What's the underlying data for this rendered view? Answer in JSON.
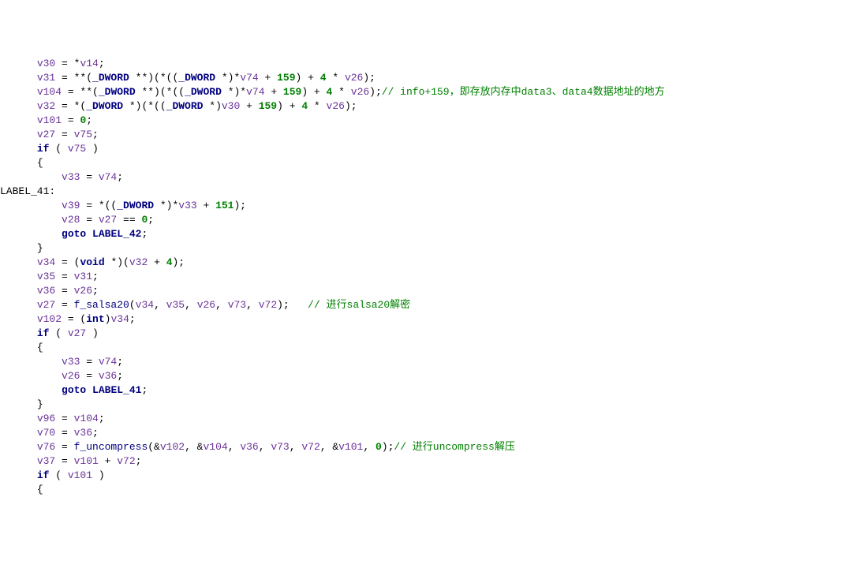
{
  "lines": [
    {
      "indent": 3,
      "tokens": [
        {
          "c": "var",
          "t": "v30"
        },
        {
          "c": "plain",
          "t": " = *"
        },
        {
          "c": "var",
          "t": "v14"
        },
        {
          "c": "plain",
          "t": ";"
        }
      ]
    },
    {
      "indent": 3,
      "tokens": [
        {
          "c": "var",
          "t": "v31"
        },
        {
          "c": "plain",
          "t": " = **("
        },
        {
          "c": "navy",
          "t": "_DWORD"
        },
        {
          "c": "plain",
          "t": " **)(*(("
        },
        {
          "c": "navy",
          "t": "_DWORD"
        },
        {
          "c": "plain",
          "t": " *)*"
        },
        {
          "c": "var",
          "t": "v74"
        },
        {
          "c": "plain",
          "t": " + "
        },
        {
          "c": "num",
          "t": "159"
        },
        {
          "c": "plain",
          "t": ") + "
        },
        {
          "c": "num",
          "t": "4"
        },
        {
          "c": "plain",
          "t": " * "
        },
        {
          "c": "var",
          "t": "v26"
        },
        {
          "c": "plain",
          "t": ");"
        }
      ]
    },
    {
      "indent": 3,
      "tokens": [
        {
          "c": "var",
          "t": "v104"
        },
        {
          "c": "plain",
          "t": " = **("
        },
        {
          "c": "navy",
          "t": "_DWORD"
        },
        {
          "c": "plain",
          "t": " **)(*(("
        },
        {
          "c": "navy",
          "t": "_DWORD"
        },
        {
          "c": "plain",
          "t": " *)*"
        },
        {
          "c": "var",
          "t": "v74"
        },
        {
          "c": "plain",
          "t": " + "
        },
        {
          "c": "num",
          "t": "159"
        },
        {
          "c": "plain",
          "t": ") + "
        },
        {
          "c": "num",
          "t": "4"
        },
        {
          "c": "plain",
          "t": " * "
        },
        {
          "c": "var",
          "t": "v26"
        },
        {
          "c": "plain",
          "t": ");"
        },
        {
          "c": "cmt",
          "t": "// info+159，即存放内存中data3、data4数据地址的地方"
        }
      ]
    },
    {
      "indent": 3,
      "tokens": [
        {
          "c": "var",
          "t": "v32"
        },
        {
          "c": "plain",
          "t": " = *("
        },
        {
          "c": "navy",
          "t": "_DWORD"
        },
        {
          "c": "plain",
          "t": " *)(*(("
        },
        {
          "c": "navy",
          "t": "_DWORD"
        },
        {
          "c": "plain",
          "t": " *)"
        },
        {
          "c": "var",
          "t": "v30"
        },
        {
          "c": "plain",
          "t": " + "
        },
        {
          "c": "num",
          "t": "159"
        },
        {
          "c": "plain",
          "t": ") + "
        },
        {
          "c": "num",
          "t": "4"
        },
        {
          "c": "plain",
          "t": " * "
        },
        {
          "c": "var",
          "t": "v26"
        },
        {
          "c": "plain",
          "t": ");"
        }
      ]
    },
    {
      "indent": 3,
      "tokens": [
        {
          "c": "var",
          "t": "v101"
        },
        {
          "c": "plain",
          "t": " = "
        },
        {
          "c": "num",
          "t": "0"
        },
        {
          "c": "plain",
          "t": ";"
        }
      ]
    },
    {
      "indent": 3,
      "tokens": [
        {
          "c": "var",
          "t": "v27"
        },
        {
          "c": "plain",
          "t": " = "
        },
        {
          "c": "var",
          "t": "v75"
        },
        {
          "c": "plain",
          "t": ";"
        }
      ]
    },
    {
      "indent": 3,
      "tokens": [
        {
          "c": "navy",
          "t": "if"
        },
        {
          "c": "plain",
          "t": " ( "
        },
        {
          "c": "var",
          "t": "v75"
        },
        {
          "c": "plain",
          "t": " )"
        }
      ]
    },
    {
      "indent": 3,
      "tokens": [
        {
          "c": "plain",
          "t": "{"
        }
      ]
    },
    {
      "indent": 5,
      "tokens": [
        {
          "c": "var",
          "t": "v33"
        },
        {
          "c": "plain",
          "t": " = "
        },
        {
          "c": "var",
          "t": "v74"
        },
        {
          "c": "plain",
          "t": ";"
        }
      ]
    },
    {
      "indent": 0,
      "tokens": [
        {
          "c": "plain",
          "t": "LABEL_41:"
        }
      ]
    },
    {
      "indent": 5,
      "tokens": [
        {
          "c": "var",
          "t": "v39"
        },
        {
          "c": "plain",
          "t": " = *(("
        },
        {
          "c": "navy",
          "t": "_DWORD"
        },
        {
          "c": "plain",
          "t": " *)*"
        },
        {
          "c": "var",
          "t": "v33"
        },
        {
          "c": "plain",
          "t": " + "
        },
        {
          "c": "num",
          "t": "151"
        },
        {
          "c": "plain",
          "t": ");"
        }
      ]
    },
    {
      "indent": 5,
      "tokens": [
        {
          "c": "var",
          "t": "v28"
        },
        {
          "c": "plain",
          "t": " = "
        },
        {
          "c": "var",
          "t": "v27"
        },
        {
          "c": "plain",
          "t": " == "
        },
        {
          "c": "num",
          "t": "0"
        },
        {
          "c": "plain",
          "t": ";"
        }
      ]
    },
    {
      "indent": 5,
      "tokens": [
        {
          "c": "navy",
          "t": "goto"
        },
        {
          "c": "plain",
          "t": " "
        },
        {
          "c": "navy",
          "t": "LABEL_42"
        },
        {
          "c": "plain",
          "t": ";"
        }
      ]
    },
    {
      "indent": 3,
      "tokens": [
        {
          "c": "plain",
          "t": "}"
        }
      ]
    },
    {
      "indent": 3,
      "tokens": [
        {
          "c": "var",
          "t": "v34"
        },
        {
          "c": "plain",
          "t": " = ("
        },
        {
          "c": "navy",
          "t": "void"
        },
        {
          "c": "plain",
          "t": " *)("
        },
        {
          "c": "var",
          "t": "v32"
        },
        {
          "c": "plain",
          "t": " + "
        },
        {
          "c": "num",
          "t": "4"
        },
        {
          "c": "plain",
          "t": ");"
        }
      ]
    },
    {
      "indent": 3,
      "tokens": [
        {
          "c": "var",
          "t": "v35"
        },
        {
          "c": "plain",
          "t": " = "
        },
        {
          "c": "var",
          "t": "v31"
        },
        {
          "c": "plain",
          "t": ";"
        }
      ]
    },
    {
      "indent": 3,
      "tokens": [
        {
          "c": "var",
          "t": "v36"
        },
        {
          "c": "plain",
          "t": " = "
        },
        {
          "c": "var",
          "t": "v26"
        },
        {
          "c": "plain",
          "t": ";"
        }
      ]
    },
    {
      "indent": 3,
      "tokens": [
        {
          "c": "var",
          "t": "v27"
        },
        {
          "c": "plain",
          "t": " = "
        },
        {
          "c": "func",
          "t": "f_salsa20"
        },
        {
          "c": "plain",
          "t": "("
        },
        {
          "c": "var",
          "t": "v34"
        },
        {
          "c": "plain",
          "t": ", "
        },
        {
          "c": "var",
          "t": "v35"
        },
        {
          "c": "plain",
          "t": ", "
        },
        {
          "c": "var",
          "t": "v26"
        },
        {
          "c": "plain",
          "t": ", "
        },
        {
          "c": "var",
          "t": "v73"
        },
        {
          "c": "plain",
          "t": ", "
        },
        {
          "c": "var",
          "t": "v72"
        },
        {
          "c": "plain",
          "t": ");   "
        },
        {
          "c": "cmt",
          "t": "// 进行salsa20解密"
        }
      ]
    },
    {
      "indent": 3,
      "tokens": [
        {
          "c": "var",
          "t": "v102"
        },
        {
          "c": "plain",
          "t": " = ("
        },
        {
          "c": "navy",
          "t": "int"
        },
        {
          "c": "plain",
          "t": ")"
        },
        {
          "c": "var",
          "t": "v34"
        },
        {
          "c": "plain",
          "t": ";"
        }
      ]
    },
    {
      "indent": 3,
      "tokens": [
        {
          "c": "navy",
          "t": "if"
        },
        {
          "c": "plain",
          "t": " ( "
        },
        {
          "c": "var",
          "t": "v27"
        },
        {
          "c": "plain",
          "t": " )"
        }
      ]
    },
    {
      "indent": 3,
      "tokens": [
        {
          "c": "plain",
          "t": "{"
        }
      ]
    },
    {
      "indent": 5,
      "tokens": [
        {
          "c": "var",
          "t": "v33"
        },
        {
          "c": "plain",
          "t": " = "
        },
        {
          "c": "var",
          "t": "v74"
        },
        {
          "c": "plain",
          "t": ";"
        }
      ]
    },
    {
      "indent": 5,
      "tokens": [
        {
          "c": "var",
          "t": "v26"
        },
        {
          "c": "plain",
          "t": " = "
        },
        {
          "c": "var",
          "t": "v36"
        },
        {
          "c": "plain",
          "t": ";"
        }
      ]
    },
    {
      "indent": 5,
      "tokens": [
        {
          "c": "navy",
          "t": "goto"
        },
        {
          "c": "plain",
          "t": " "
        },
        {
          "c": "navy",
          "t": "LABEL_41"
        },
        {
          "c": "plain",
          "t": ";"
        }
      ]
    },
    {
      "indent": 3,
      "tokens": [
        {
          "c": "plain",
          "t": "}"
        }
      ]
    },
    {
      "indent": 3,
      "tokens": [
        {
          "c": "var",
          "t": "v96"
        },
        {
          "c": "plain",
          "t": " = "
        },
        {
          "c": "var",
          "t": "v104"
        },
        {
          "c": "plain",
          "t": ";"
        }
      ]
    },
    {
      "indent": 3,
      "tokens": [
        {
          "c": "var",
          "t": "v70"
        },
        {
          "c": "plain",
          "t": " = "
        },
        {
          "c": "var",
          "t": "v36"
        },
        {
          "c": "plain",
          "t": ";"
        }
      ]
    },
    {
      "indent": 3,
      "tokens": [
        {
          "c": "var",
          "t": "v76"
        },
        {
          "c": "plain",
          "t": " = "
        },
        {
          "c": "func",
          "t": "f_uncompress"
        },
        {
          "c": "plain",
          "t": "(&"
        },
        {
          "c": "var",
          "t": "v102"
        },
        {
          "c": "plain",
          "t": ", &"
        },
        {
          "c": "var",
          "t": "v104"
        },
        {
          "c": "plain",
          "t": ", "
        },
        {
          "c": "var",
          "t": "v36"
        },
        {
          "c": "plain",
          "t": ", "
        },
        {
          "c": "var",
          "t": "v73"
        },
        {
          "c": "plain",
          "t": ", "
        },
        {
          "c": "var",
          "t": "v72"
        },
        {
          "c": "plain",
          "t": ", &"
        },
        {
          "c": "var",
          "t": "v101"
        },
        {
          "c": "plain",
          "t": ", "
        },
        {
          "c": "num",
          "t": "0"
        },
        {
          "c": "plain",
          "t": ");"
        },
        {
          "c": "cmt",
          "t": "// 进行uncompress解压"
        }
      ]
    },
    {
      "indent": 3,
      "tokens": [
        {
          "c": "var",
          "t": "v37"
        },
        {
          "c": "plain",
          "t": " = "
        },
        {
          "c": "var",
          "t": "v101"
        },
        {
          "c": "plain",
          "t": " + "
        },
        {
          "c": "var",
          "t": "v72"
        },
        {
          "c": "plain",
          "t": ";"
        }
      ]
    },
    {
      "indent": 3,
      "tokens": [
        {
          "c": "navy",
          "t": "if"
        },
        {
          "c": "plain",
          "t": " ( "
        },
        {
          "c": "var",
          "t": "v101"
        },
        {
          "c": "plain",
          "t": " )"
        }
      ]
    },
    {
      "indent": 3,
      "tokens": [
        {
          "c": "plain",
          "t": "{"
        }
      ]
    }
  ]
}
